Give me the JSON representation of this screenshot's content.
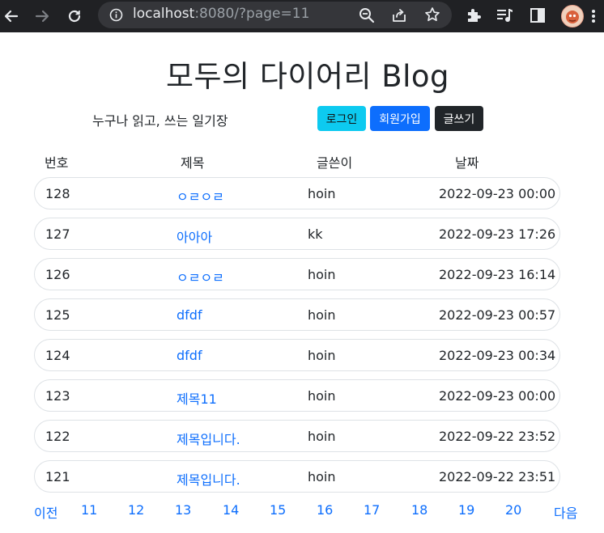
{
  "browser": {
    "url_host": "localhost",
    "url_rest": ":8080/?page=11"
  },
  "page": {
    "title": "모두의 다이어리 Blog",
    "slogan": "누구나 읽고, 쓰는 일기장",
    "buttons": {
      "login": "로그인",
      "signup": "회원가입",
      "write": "글쓰기"
    }
  },
  "table": {
    "headers": {
      "number": "번호",
      "title": "제목",
      "writer": "글쓴이",
      "date": "날짜"
    },
    "rows": [
      {
        "number": "128",
        "title": "ㅇㄹㅇㄹ",
        "writer": "hoin",
        "date": "2022-09-23 00:00"
      },
      {
        "number": "127",
        "title": "아아아",
        "writer": "kk",
        "date": "2022-09-23 17:26"
      },
      {
        "number": "126",
        "title": "ㅇㄹㅇㄹ",
        "writer": "hoin",
        "date": "2022-09-23 16:14"
      },
      {
        "number": "125",
        "title": "dfdf",
        "writer": "hoin",
        "date": "2022-09-23 00:57"
      },
      {
        "number": "124",
        "title": "dfdf",
        "writer": "hoin",
        "date": "2022-09-23 00:34"
      },
      {
        "number": "123",
        "title": "제목11",
        "writer": "hoin",
        "date": "2022-09-23 00:00"
      },
      {
        "number": "122",
        "title": "제목입니다.",
        "writer": "hoin",
        "date": "2022-09-22 23:52"
      },
      {
        "number": "121",
        "title": "제목입니다.",
        "writer": "hoin",
        "date": "2022-09-22 23:51"
      }
    ]
  },
  "pagination": {
    "prev": "이전",
    "pages": [
      "11",
      "12",
      "13",
      "14",
      "15",
      "16",
      "17",
      "18",
      "19",
      "20"
    ],
    "next": "다음"
  }
}
